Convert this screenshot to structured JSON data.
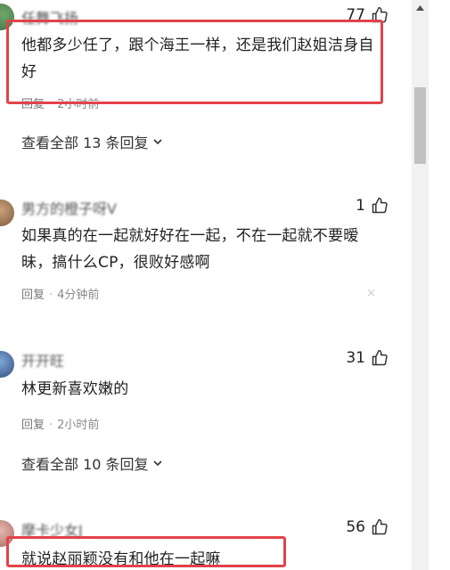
{
  "comments": [
    {
      "username": "任舞飞扬",
      "likes": "77",
      "text": "他都多少任了，跟个海王一样，还是我们赵姐洁身自好",
      "reply_label": "回复",
      "separator": "·",
      "time": "2小时前",
      "view_all": "查看全部 13 条回复"
    },
    {
      "username": "男方的橙子呀V",
      "likes": "1",
      "text": "如果真的在一起就好好在一起，不在一起就不要暧昧，搞什么CP，很败好感啊",
      "reply_label": "回复",
      "separator": "·",
      "time": "4分钟前",
      "dismiss": "×"
    },
    {
      "username": "开开旺",
      "likes": "31",
      "text": "林更新喜欢嫩的",
      "reply_label": "回复",
      "separator": "·",
      "time": "2小时前",
      "view_all": "查看全部 10 条回复"
    },
    {
      "username": "摩卡少女J",
      "likes": "56",
      "text": "就说赵丽颖没有和他在一起嘛"
    }
  ],
  "colors": {
    "highlight": "#e2434a",
    "meta": "#888888",
    "text": "#222222"
  }
}
